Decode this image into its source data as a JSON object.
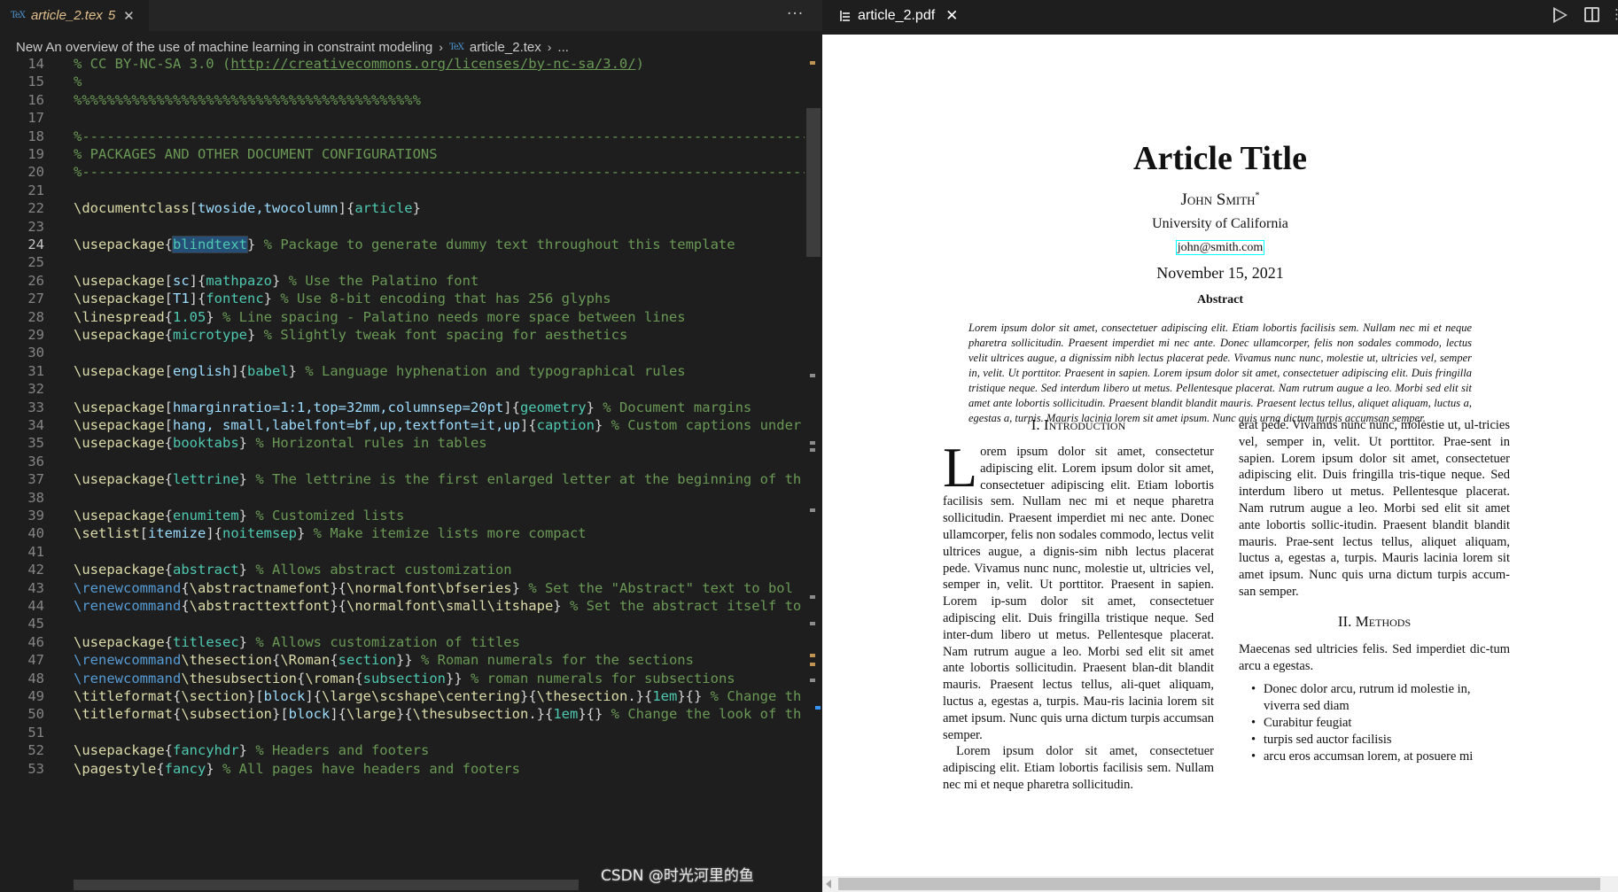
{
  "editor": {
    "tab": {
      "icon": "TeX",
      "title": "article_2.tex",
      "problems": "5",
      "close": "✕"
    },
    "more_actions": "···",
    "breadcrumb": {
      "folder": "New An overview of the use of machine learning in constraint modeling",
      "file_icon": "TeX",
      "file": "article_2.tex",
      "tail": "..."
    },
    "lines": [
      {
        "n": "14",
        "text": "% CC BY-NC-SA 3.0 (http://creativecommons.org/licenses/by-nc-sa/3.0/)"
      },
      {
        "n": "15",
        "text": "%"
      },
      {
        "n": "16",
        "text": "%%%%%%%%%%%%%%%%%%%%%%%%%%%%%%%%%%%%%%%%%%"
      },
      {
        "n": "17",
        "text": ""
      },
      {
        "n": "18",
        "text": "%----------------------------------------------------------------------------------------"
      },
      {
        "n": "19",
        "text": "% PACKAGES AND OTHER DOCUMENT CONFIGURATIONS"
      },
      {
        "n": "20",
        "text": "%----------------------------------------------------------------------------------------"
      },
      {
        "n": "21",
        "text": ""
      },
      {
        "n": "22",
        "text": "\\documentclass[twoside,twocolumn]{article}"
      },
      {
        "n": "23",
        "text": ""
      },
      {
        "n": "24",
        "text": "\\usepackage{blindtext} % Package to generate dummy text throughout this template"
      },
      {
        "n": "25",
        "text": ""
      },
      {
        "n": "26",
        "text": "\\usepackage[sc]{mathpazo} % Use the Palatino font"
      },
      {
        "n": "27",
        "text": "\\usepackage[T1]{fontenc} % Use 8-bit encoding that has 256 glyphs"
      },
      {
        "n": "28",
        "text": "\\linespread{1.05} % Line spacing - Palatino needs more space between lines"
      },
      {
        "n": "29",
        "text": "\\usepackage{microtype} % Slightly tweak font spacing for aesthetics"
      },
      {
        "n": "30",
        "text": ""
      },
      {
        "n": "31",
        "text": "\\usepackage[english]{babel} % Language hyphenation and typographical rules"
      },
      {
        "n": "32",
        "text": ""
      },
      {
        "n": "33",
        "text": "\\usepackage[hmarginratio=1:1,top=32mm,columnsep=20pt]{geometry} % Document margins"
      },
      {
        "n": "34",
        "text": "\\usepackage[hang, small,labelfont=bf,up,textfont=it,up]{caption} % Custom captions under"
      },
      {
        "n": "35",
        "text": "\\usepackage{booktabs} % Horizontal rules in tables"
      },
      {
        "n": "36",
        "text": ""
      },
      {
        "n": "37",
        "text": "\\usepackage{lettrine} % The lettrine is the first enlarged letter at the beginning of th"
      },
      {
        "n": "38",
        "text": ""
      },
      {
        "n": "39",
        "text": "\\usepackage{enumitem} % Customized lists"
      },
      {
        "n": "40",
        "text": "\\setlist[itemize]{noitemsep} % Make itemize lists more compact"
      },
      {
        "n": "41",
        "text": ""
      },
      {
        "n": "42",
        "text": "\\usepackage{abstract} % Allows abstract customization"
      },
      {
        "n": "43",
        "text": "\\renewcommand{\\abstractnamefont}{\\normalfont\\bfseries} % Set the \"Abstract\" text to bol"
      },
      {
        "n": "44",
        "text": "\\renewcommand{\\abstracttextfont}{\\normalfont\\small\\itshape} % Set the abstract itself to"
      },
      {
        "n": "45",
        "text": ""
      },
      {
        "n": "46",
        "text": "\\usepackage{titlesec} % Allows customization of titles"
      },
      {
        "n": "47",
        "text": "\\renewcommand\\thesection{\\Roman{section}} % Roman numerals for the sections"
      },
      {
        "n": "48",
        "text": "\\renewcommand\\thesubsection{\\roman{subsection}} % roman numerals for subsections"
      },
      {
        "n": "49",
        "text": "\\titleformat{\\section}[block]{\\large\\scshape\\centering}{\\thesection.}{1em}{} % Change th"
      },
      {
        "n": "50",
        "text": "\\titleformat{\\subsection}[block]{\\large}{\\thesubsection.}{1em}{} % Change the look of th"
      },
      {
        "n": "51",
        "text": ""
      },
      {
        "n": "52",
        "text": "\\usepackage{fancyhdr} % Headers and footers"
      },
      {
        "n": "53",
        "text": "\\pagestyle{fancy} % All pages have headers and footers"
      }
    ],
    "active_line": "24",
    "colors": {
      "background": "#1e1e1e",
      "comment": "#6a9955",
      "command": "#dcdcaa",
      "keyword": "#569cd6",
      "argument": "#9cdcfe",
      "environment": "#4ec9b0",
      "modified_tab": "#e2c08d"
    }
  },
  "viewer": {
    "tab": {
      "title": "article_2.pdf",
      "close": "✕"
    },
    "actions": {
      "run": "run-icon",
      "split": "split-editor-icon",
      "more": "⋮"
    },
    "pdf": {
      "title": "Article Title",
      "author": "John Smith",
      "author_mark": "*",
      "affiliation": "University of California",
      "email": "john@smith.com",
      "date": "November 15, 2021",
      "abstract_heading": "Abstract",
      "abstract_text": "Lorem ipsum dolor sit amet, consectetuer adipiscing elit. Etiam lobortis facilisis sem. Nullam nec mi et neque pharetra sollicitudin. Praesent imperdiet mi nec ante. Donec ullamcorper, felis non sodales commodo, lectus velit ultrices augue, a dignissim nibh lectus placerat pede. Vivamus nunc nunc, molestie ut, ultricies vel, semper in, velit. Ut porttitor. Praesent in sapien. Lorem ipsum dolor sit amet, consectetuer adipiscing elit. Duis fringilla tristique neque. Sed interdum libero ut metus. Pellentesque placerat. Nam rutrum augue a leo. Morbi sed elit sit amet ante lobortis sollicitudin. Praesent blandit blandit mauris. Praesent lectus tellus, aliquet aliquam, luctus a, egestas a, turpis. Mauris lacinia lorem sit amet ipsum. Nunc quis urna dictum turpis accumsan semper.",
      "section1_heading": "I.  Introduction",
      "dropcap": "L",
      "section1_para1": "orem ipsum dolor sit amet, consectetur adipiscing elit. Lorem ipsum dolor sit amet, consectetuer adipiscing elit. Etiam lobortis facilisis sem. Nullam nec mi et neque pharetra sollicitudin. Praesent imperdiet mi nec ante. Donec ullamcorper, felis non sodales commodo, lectus velit ultrices augue, a dignis-sim nibh lectus placerat pede. Vivamus nunc nunc, molestie ut, ultricies vel, semper in, velit. Ut porttitor. Praesent in sapien. Lorem ip-sum dolor sit amet, consectetuer adipiscing elit. Duis fringilla tristique neque. Sed inter-dum libero ut metus. Pellentesque placerat. Nam rutrum augue a leo. Morbi sed elit sit amet ante lobortis sollicitudin. Praesent blan-dit blandit mauris. Praesent lectus tellus, ali-quet aliquam, luctus a, egestas a, turpis. Mau-ris lacinia lorem sit amet ipsum. Nunc quis urna dictum turpis accumsan semper.",
      "section1_para2": "Lorem ipsum dolor sit amet, consectetuer adipiscing elit. Etiam lobortis facilisis sem. Nullam nec mi et neque pharetra sollicitudin.",
      "right_col_para": "erat pede. Vivamus nunc nunc, molestie ut, ul-tricies vel, semper in, velit. Ut porttitor. Prae-sent in sapien. Lorem ipsum dolor sit amet, consectetuer adipiscing elit. Duis fringilla tris-tique neque. Sed interdum libero ut metus. Pellentesque placerat. Nam rutrum augue a leo. Morbi sed elit sit amet ante lobortis sollic-itudin. Praesent blandit blandit mauris. Prae-sent lectus tellus, aliquet aliquam, luctus a, egestas a, turpis. Mauris lacinia lorem sit amet ipsum. Nunc quis urna dictum turpis accum-san semper.",
      "section2_heading": "II.  Methods",
      "section2_para": "Maecenas sed ultricies felis. Sed imperdiet dic-tum arcu a egestas.",
      "bullets": [
        {
          "text": "Donec dolor arcu, rutrum id molestie in,",
          "cont": "viverra sed diam"
        },
        {
          "text": "Curabitur feugiat",
          "cont": ""
        },
        {
          "text": "turpis sed auctor facilisis",
          "cont": ""
        },
        {
          "text": "arcu eros accumsan lorem, at posuere mi",
          "cont": ""
        }
      ],
      "bullet_glyph": "•"
    },
    "watermark": "CSDN @时光河里的鱼"
  }
}
